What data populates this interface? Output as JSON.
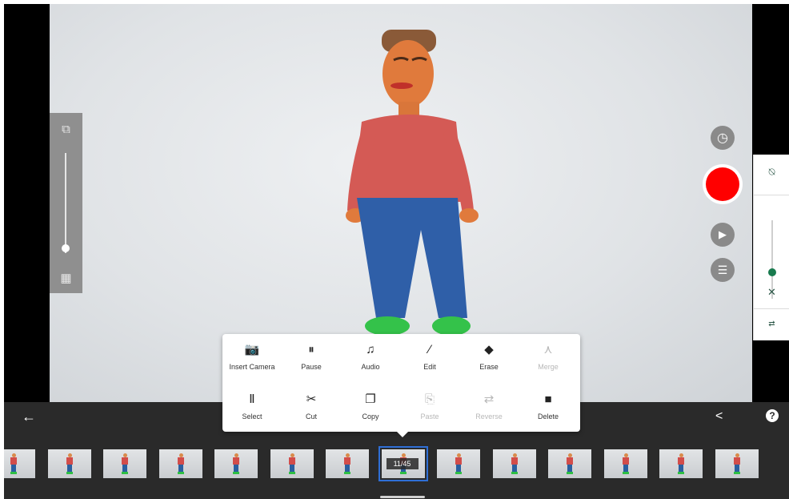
{
  "left_panel": {
    "top_icon": "copy-layers-icon",
    "bottom_icon": "grid-overlay-icon",
    "slider_value": 0.92
  },
  "right_controls": {
    "timer_icon": "clock-icon",
    "record_color": "#ff0000",
    "play_icon": "play-icon",
    "settings_icon": "sliders-icon"
  },
  "right_panel": {
    "top_icon": "muted-bell-icon",
    "slider_icon": "volume-off-icon",
    "bottom_icon": "adjust-icon",
    "slider_value": 0.62
  },
  "menu": {
    "items": [
      {
        "label": "Insert Camera",
        "icon": "camera-icon",
        "glyph": "📷",
        "enabled": true
      },
      {
        "label": "Pause",
        "icon": "pause-icon",
        "glyph": "⏸",
        "enabled": true
      },
      {
        "label": "Audio",
        "icon": "music-note-icon",
        "glyph": "♫",
        "enabled": true
      },
      {
        "label": "Edit",
        "icon": "brush-icon",
        "glyph": "∕",
        "enabled": true
      },
      {
        "label": "Erase",
        "icon": "eraser-icon",
        "glyph": "◆",
        "enabled": true
      },
      {
        "label": "Merge",
        "icon": "merge-icon",
        "glyph": "⋏",
        "enabled": false
      },
      {
        "label": "Select",
        "icon": "select-frames-icon",
        "glyph": "Ⅱ",
        "enabled": true
      },
      {
        "label": "Cut",
        "icon": "scissors-icon",
        "glyph": "✂",
        "enabled": true
      },
      {
        "label": "Copy",
        "icon": "copy-icon",
        "glyph": "❐",
        "enabled": true
      },
      {
        "label": "Paste",
        "icon": "clipboard-icon",
        "glyph": "⎘",
        "enabled": false
      },
      {
        "label": "Reverse",
        "icon": "reverse-icon",
        "glyph": "⇄",
        "enabled": false
      },
      {
        "label": "Delete",
        "icon": "trash-icon",
        "glyph": "■",
        "enabled": true
      }
    ]
  },
  "bottom_bar": {
    "back_icon": "arrow-left-icon",
    "share_icon": "share-icon",
    "help_icon": "help-icon",
    "help_glyph": "?"
  },
  "timeline": {
    "frame_counter": "11/45",
    "selected_index": 7,
    "visible_frames": 14
  }
}
